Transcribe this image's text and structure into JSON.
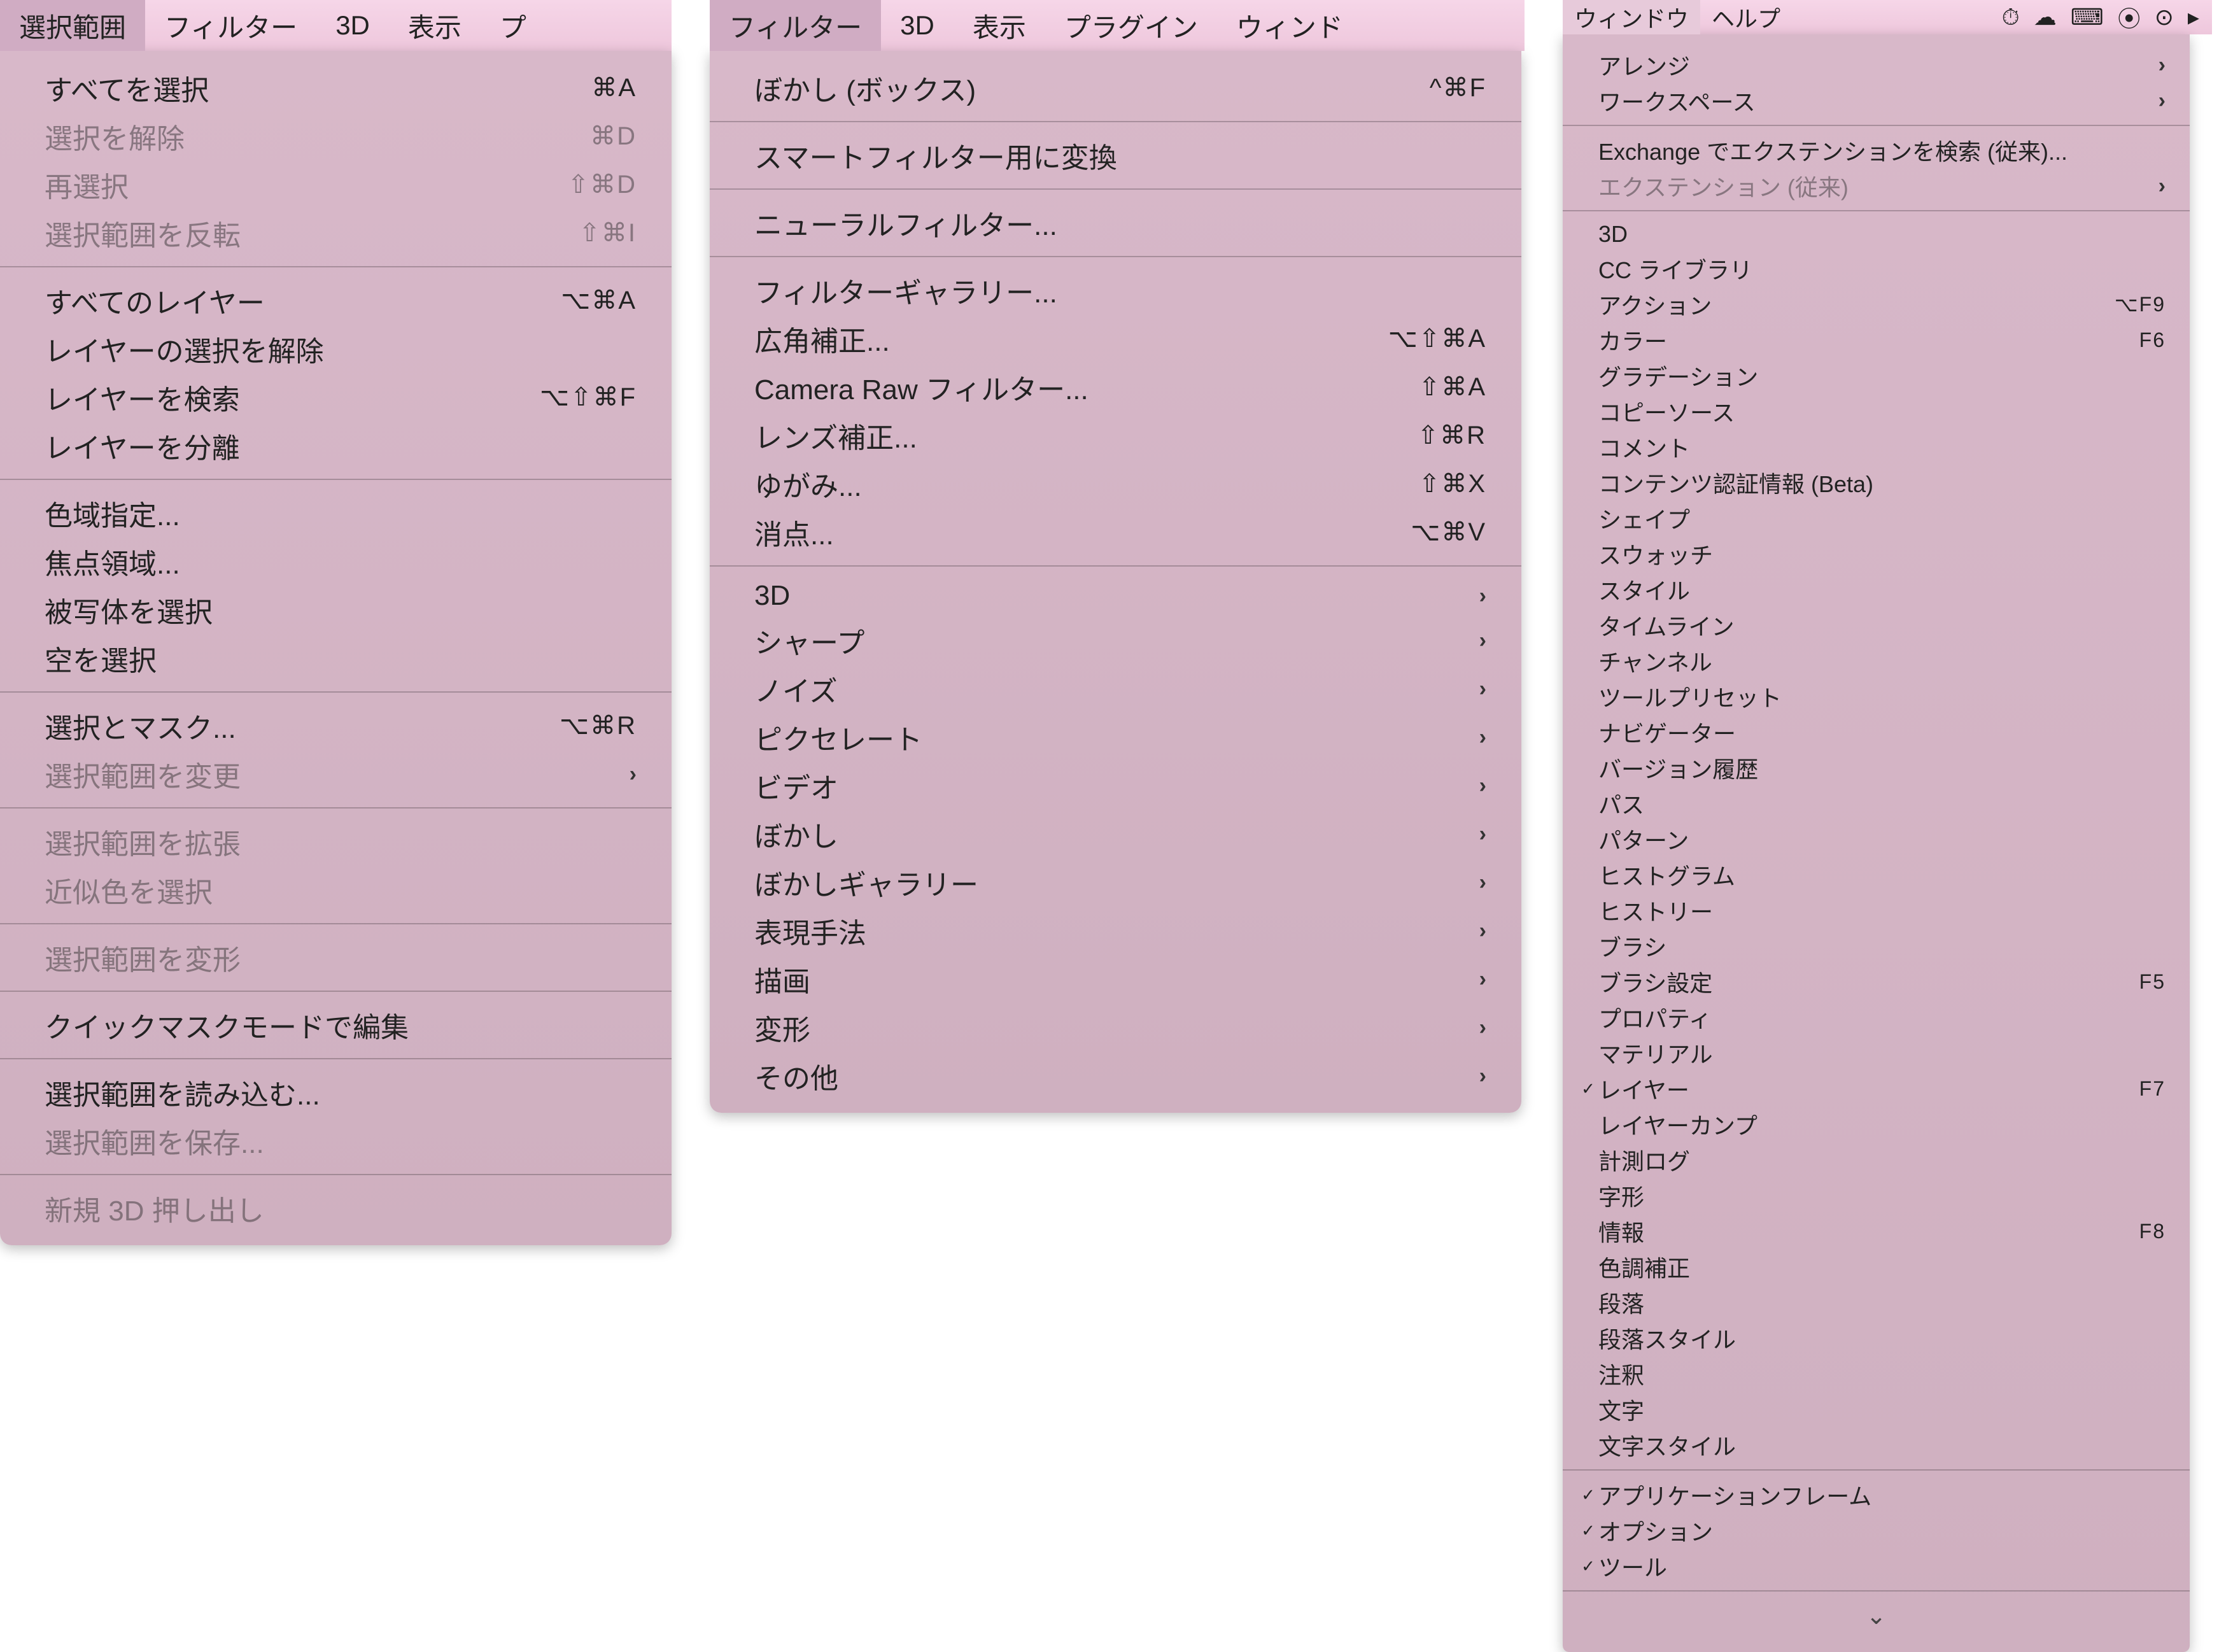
{
  "panel1": {
    "menubar": [
      "選択範囲",
      "フィルター",
      "3D",
      "表示",
      "プ"
    ],
    "selected": 0,
    "groups": [
      [
        {
          "label": "すべてを選択",
          "shortcut": "⌘A"
        },
        {
          "label": "選択を解除",
          "shortcut": "⌘D",
          "disabled": true
        },
        {
          "label": "再選択",
          "shortcut": "⇧⌘D",
          "disabled": true
        },
        {
          "label": "選択範囲を反転",
          "shortcut": "⇧⌘I",
          "disabled": true
        }
      ],
      [
        {
          "label": "すべてのレイヤー",
          "shortcut": "⌥⌘A"
        },
        {
          "label": "レイヤーの選択を解除"
        },
        {
          "label": "レイヤーを検索",
          "shortcut": "⌥⇧⌘F"
        },
        {
          "label": "レイヤーを分離"
        }
      ],
      [
        {
          "label": "色域指定..."
        },
        {
          "label": "焦点領域..."
        },
        {
          "label": "被写体を選択"
        },
        {
          "label": "空を選択"
        }
      ],
      [
        {
          "label": "選択とマスク...",
          "shortcut": "⌥⌘R"
        },
        {
          "label": "選択範囲を変更",
          "submenu": true,
          "disabled": true
        }
      ],
      [
        {
          "label": "選択範囲を拡張",
          "disabled": true
        },
        {
          "label": "近似色を選択",
          "disabled": true
        }
      ],
      [
        {
          "label": "選択範囲を変形",
          "disabled": true
        }
      ],
      [
        {
          "label": "クイックマスクモードで編集"
        }
      ],
      [
        {
          "label": "選択範囲を読み込む..."
        },
        {
          "label": "選択範囲を保存...",
          "disabled": true
        }
      ],
      [
        {
          "label": "新規 3D 押し出し",
          "disabled": true
        }
      ]
    ]
  },
  "panel2": {
    "menubar": [
      "フィルター",
      "3D",
      "表示",
      "プラグイン",
      "ウィンド"
    ],
    "selected": 0,
    "groups": [
      [
        {
          "label": "ぼかし (ボックス)",
          "shortcut": "^⌘F"
        }
      ],
      [
        {
          "label": "スマートフィルター用に変換"
        }
      ],
      [
        {
          "label": "ニューラルフィルター..."
        }
      ],
      [
        {
          "label": "フィルターギャラリー..."
        },
        {
          "label": "広角補正...",
          "shortcut": "⌥⇧⌘A"
        },
        {
          "label": "Camera Raw フィルター...",
          "shortcut": "⇧⌘A"
        },
        {
          "label": "レンズ補正...",
          "shortcut": "⇧⌘R"
        },
        {
          "label": "ゆがみ...",
          "shortcut": "⇧⌘X"
        },
        {
          "label": "消点...",
          "shortcut": "⌥⌘V"
        }
      ],
      [
        {
          "label": "3D",
          "submenu": true
        },
        {
          "label": "シャープ",
          "submenu": true
        },
        {
          "label": "ノイズ",
          "submenu": true
        },
        {
          "label": "ピクセレート",
          "submenu": true
        },
        {
          "label": "ビデオ",
          "submenu": true
        },
        {
          "label": "ぼかし",
          "submenu": true
        },
        {
          "label": "ぼかしギャラリー",
          "submenu": true
        },
        {
          "label": "表現手法",
          "submenu": true
        },
        {
          "label": "描画",
          "submenu": true
        },
        {
          "label": "変形",
          "submenu": true
        },
        {
          "label": "その他",
          "submenu": true
        }
      ]
    ]
  },
  "panel3": {
    "menubar": [
      "ウィンドウ",
      "ヘルプ"
    ],
    "selected": 0,
    "status_icons": [
      "⏱",
      "☁",
      "⌨",
      "⦿",
      "⊙",
      "▸"
    ],
    "groups": [
      [
        {
          "label": "アレンジ",
          "submenu": true
        },
        {
          "label": "ワークスペース",
          "submenu": true
        }
      ],
      [
        {
          "label": "Exchange でエクステンションを検索 (従来)..."
        },
        {
          "label": "エクステンション (従来)",
          "submenu": true,
          "disabled": true
        }
      ],
      [
        {
          "label": "3D"
        },
        {
          "label": "CC ライブラリ"
        },
        {
          "label": "アクション",
          "shortcut": "⌥F9"
        },
        {
          "label": "カラー",
          "shortcut": "F6"
        },
        {
          "label": "グラデーション"
        },
        {
          "label": "コピーソース"
        },
        {
          "label": "コメント"
        },
        {
          "label": "コンテンツ認証情報 (Beta)"
        },
        {
          "label": "シェイプ"
        },
        {
          "label": "スウォッチ"
        },
        {
          "label": "スタイル"
        },
        {
          "label": "タイムライン"
        },
        {
          "label": "チャンネル"
        },
        {
          "label": "ツールプリセット"
        },
        {
          "label": "ナビゲーター"
        },
        {
          "label": "バージョン履歴"
        },
        {
          "label": "パス"
        },
        {
          "label": "パターン"
        },
        {
          "label": "ヒストグラム"
        },
        {
          "label": "ヒストリー"
        },
        {
          "label": "ブラシ"
        },
        {
          "label": "ブラシ設定",
          "shortcut": "F5"
        },
        {
          "label": "プロパティ"
        },
        {
          "label": "マテリアル"
        },
        {
          "label": "レイヤー",
          "shortcut": "F7",
          "checked": true
        },
        {
          "label": "レイヤーカンプ"
        },
        {
          "label": "計測ログ"
        },
        {
          "label": "字形"
        },
        {
          "label": "情報",
          "shortcut": "F8"
        },
        {
          "label": "色調補正"
        },
        {
          "label": "段落"
        },
        {
          "label": "段落スタイル"
        },
        {
          "label": "注釈"
        },
        {
          "label": "文字"
        },
        {
          "label": "文字スタイル"
        }
      ],
      [
        {
          "label": "アプリケーションフレーム",
          "checked": true
        },
        {
          "label": "オプション",
          "checked": true
        },
        {
          "label": "ツール",
          "checked": true
        }
      ]
    ],
    "scroll_arrow": "⌄"
  }
}
